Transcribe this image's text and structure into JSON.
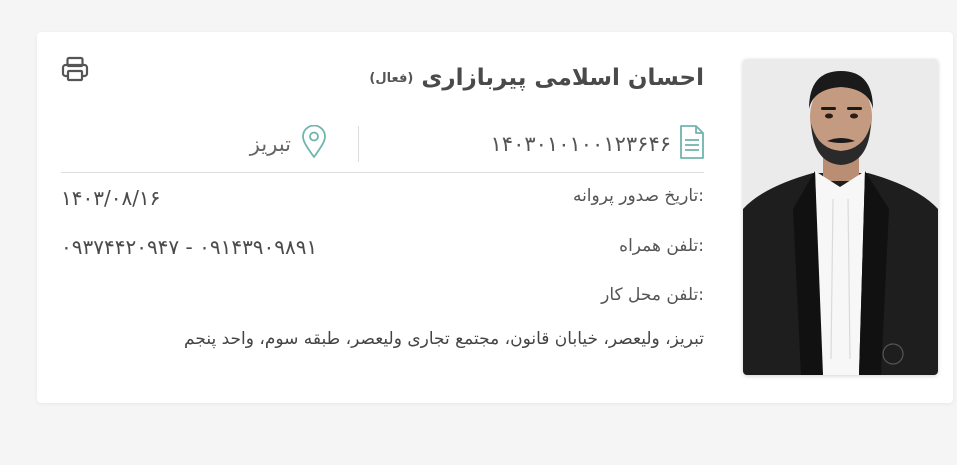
{
  "lawyer": {
    "name": "احسان اسلامی پیربازاری",
    "status": "(فعال)",
    "license_number": "۱۴۰۳۰۱۰۱۰۰۱۲۳۶۴۶",
    "city": "تبریز"
  },
  "details": {
    "issue_date_label": "تاریخ صدور پروانه:",
    "issue_date_value": "۱۴۰۳/۰۸/۱۶",
    "mobile_label": "تلفن همراه:",
    "mobile_value": "۰۹۳۷۴۴۲۰۹۴۷ - ۰۹۱۴۳۹۰۹۸۹۱",
    "office_phone_label": "تلفن محل کار:",
    "address": "تبریز، ولیعصر، خیابان قانون، مجتمع تجاری ولیعصر، طبقه سوم، واحد پنجم"
  },
  "icons": {
    "print": "printer-icon",
    "license": "document-icon",
    "location": "location-pin-icon"
  },
  "colors": {
    "accent": "#6fb5ad",
    "text": "#4a4a4a",
    "icon_gray": "#555555"
  }
}
